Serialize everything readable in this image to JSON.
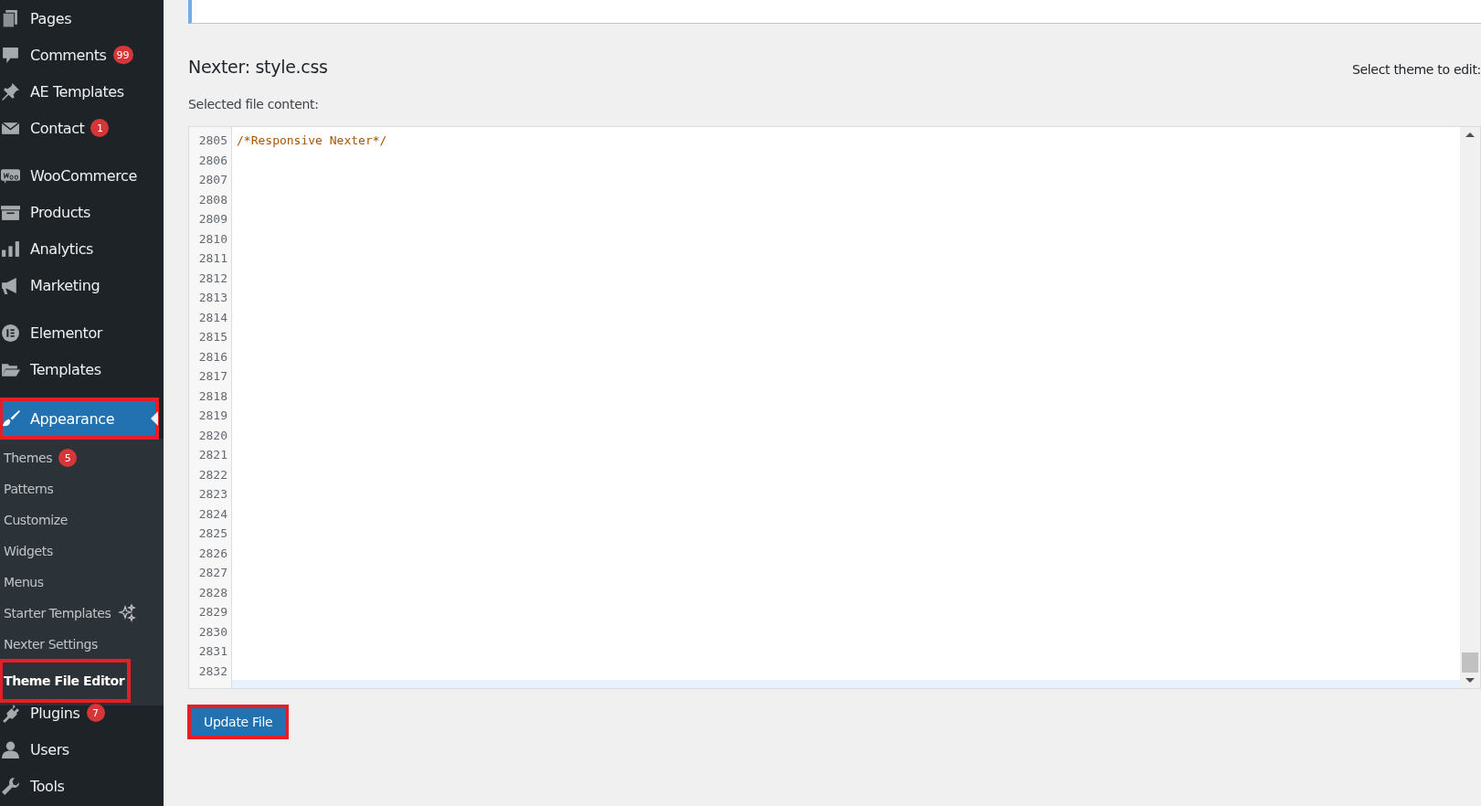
{
  "sidebar": {
    "groups": [
      [
        {
          "label": "Pages",
          "current": false,
          "highlighted": false
        },
        {
          "label": "Comments",
          "badge": "99",
          "current": false,
          "highlighted": false
        },
        {
          "label": "AE Templates",
          "current": false,
          "highlighted": false
        },
        {
          "label": "Contact",
          "badge": "1",
          "current": false,
          "highlighted": false
        }
      ],
      [
        {
          "label": "WooCommerce",
          "current": false,
          "highlighted": false
        },
        {
          "label": "Products",
          "current": false,
          "highlighted": false
        },
        {
          "label": "Analytics",
          "current": false,
          "highlighted": false
        },
        {
          "label": "Marketing",
          "current": false,
          "highlighted": false
        }
      ],
      [
        {
          "label": "Elementor",
          "current": false,
          "highlighted": false
        },
        {
          "label": "Templates",
          "current": false,
          "highlighted": false
        }
      ],
      [
        {
          "label": "Appearance",
          "current": true,
          "highlighted": true,
          "children": [
            {
              "label": "Themes",
              "badge": "5",
              "current": false,
              "highlighted": false
            },
            {
              "label": "Patterns",
              "current": false,
              "highlighted": false
            },
            {
              "label": "Customize",
              "current": false,
              "highlighted": false
            },
            {
              "label": "Widgets",
              "current": false,
              "highlighted": false
            },
            {
              "label": "Menus",
              "current": false,
              "highlighted": false
            },
            {
              "label": "Starter Templates",
              "sparkle": true,
              "current": false,
              "highlighted": false
            },
            {
              "label": "Nexter Settings",
              "current": false,
              "highlighted": false
            },
            {
              "label": "Theme File Editor",
              "current": true,
              "highlighted": true
            }
          ]
        },
        {
          "label": "Plugins",
          "badge": "7",
          "current": false,
          "highlighted": false
        },
        {
          "label": "Users",
          "current": false,
          "highlighted": false
        },
        {
          "label": "Tools",
          "current": false,
          "highlighted": false
        }
      ]
    ]
  },
  "main": {
    "heading": "Nexter: style.css",
    "theme_select_label": "Select theme to edit:",
    "content_label": "Selected file content:",
    "editor": {
      "lines": [
        {
          "number": "2805",
          "text": "/*Responsive Nexter*/"
        },
        {
          "number": "2806"
        },
        {
          "number": "2807"
        },
        {
          "number": "2808"
        },
        {
          "number": "2809"
        },
        {
          "number": "2810"
        },
        {
          "number": "2811"
        },
        {
          "number": "2812"
        },
        {
          "number": "2813"
        },
        {
          "number": "2814"
        },
        {
          "number": "2815"
        },
        {
          "number": "2816"
        },
        {
          "number": "2817"
        },
        {
          "number": "2818"
        },
        {
          "number": "2819"
        },
        {
          "number": "2820"
        },
        {
          "number": "2821"
        },
        {
          "number": "2822"
        },
        {
          "number": "2823"
        },
        {
          "number": "2824"
        },
        {
          "number": "2825"
        },
        {
          "number": "2826"
        },
        {
          "number": "2827"
        },
        {
          "number": "2828"
        },
        {
          "number": "2829"
        },
        {
          "number": "2830"
        },
        {
          "number": "2831"
        },
        {
          "number": "2832"
        }
      ]
    },
    "update_button": {
      "label": "Update File",
      "highlighted": true
    }
  }
}
